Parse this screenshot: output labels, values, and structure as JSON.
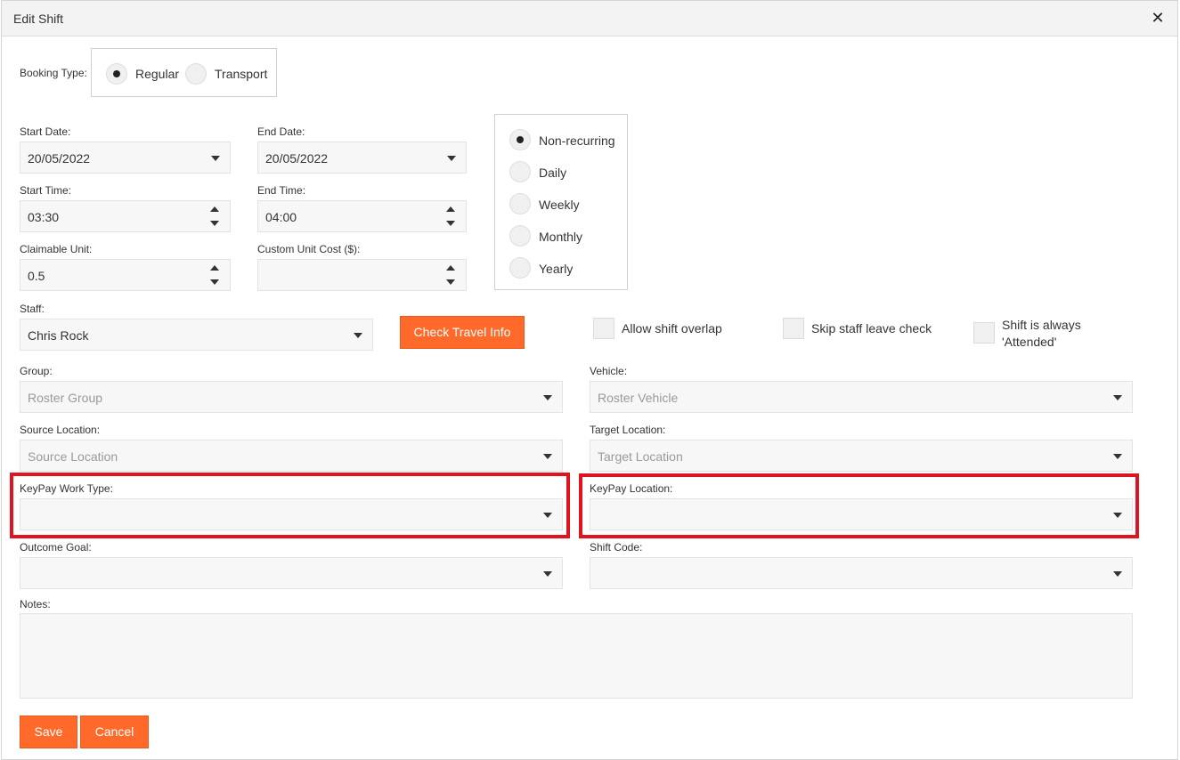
{
  "dialog": {
    "title": "Edit Shift",
    "close_icon": "close-icon"
  },
  "booking_type": {
    "label": "Booking Type:",
    "options": [
      "Regular",
      "Transport"
    ],
    "selected": "Regular"
  },
  "start_date": {
    "label": "Start Date:",
    "value": "20/05/2022"
  },
  "end_date": {
    "label": "End Date:",
    "value": "20/05/2022"
  },
  "start_time": {
    "label": "Start Time:",
    "value": "03:30"
  },
  "end_time": {
    "label": "End Time:",
    "value": "04:00"
  },
  "claimable_unit": {
    "label": "Claimable Unit:",
    "value": "0.5"
  },
  "custom_unit_cost": {
    "label": "Custom Unit Cost ($):",
    "value": ""
  },
  "recurrence": {
    "options": [
      "Non-recurring",
      "Daily",
      "Weekly",
      "Monthly",
      "Yearly"
    ],
    "selected": "Non-recurring"
  },
  "staff": {
    "label": "Staff:",
    "value": "Chris Rock"
  },
  "check_travel_button": "Check Travel Info",
  "checkboxes": {
    "allow_overlap": "Allow shift overlap",
    "skip_leave": "Skip staff leave check",
    "always_attended": "Shift is always 'Attended'"
  },
  "group": {
    "label": "Group:",
    "placeholder": "Roster Group"
  },
  "vehicle": {
    "label": "Vehicle:",
    "placeholder": "Roster Vehicle"
  },
  "source_location": {
    "label": "Source Location:",
    "placeholder": "Source Location"
  },
  "target_location": {
    "label": "Target Location:",
    "placeholder": "Target Location"
  },
  "keypay_work_type": {
    "label": "KeyPay Work Type:",
    "value": ""
  },
  "keypay_location": {
    "label": "KeyPay Location:",
    "value": ""
  },
  "outcome_goal": {
    "label": "Outcome Goal:",
    "value": ""
  },
  "shift_code": {
    "label": "Shift Code:",
    "value": ""
  },
  "notes": {
    "label": "Notes:",
    "value": ""
  },
  "footer": {
    "save": "Save",
    "cancel": "Cancel"
  },
  "colors": {
    "accent": "#ff6a2b",
    "highlight": "#e0141e"
  }
}
